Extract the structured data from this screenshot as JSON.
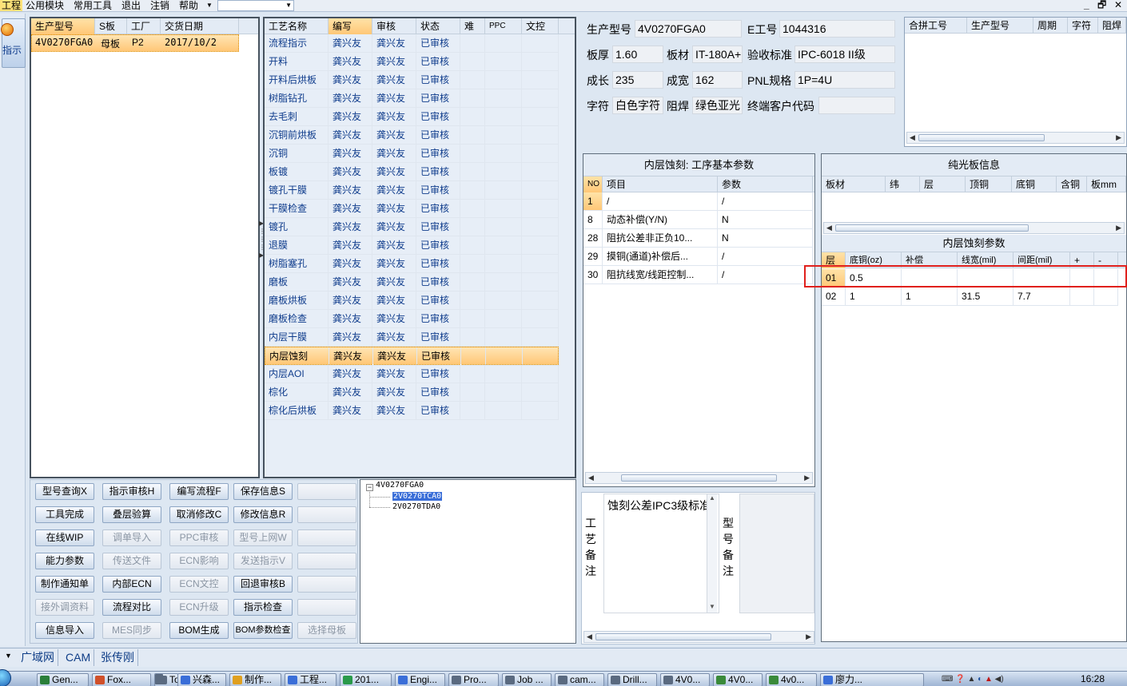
{
  "menubar": {
    "items": [
      "工程",
      "公用模块",
      "常用工具",
      "退出",
      "注销",
      "帮助"
    ],
    "window_buttons": [
      "_",
      "🗗",
      "✕"
    ]
  },
  "left_toolbar": {
    "label": "指示"
  },
  "model_list": {
    "columns": [
      "生产型号",
      "S板",
      "工厂",
      "交货日期"
    ],
    "rows": [
      [
        "4V0270FGA0",
        "母板",
        "P2",
        "2017/10/2"
      ]
    ]
  },
  "process_list": {
    "columns": [
      "工艺名称",
      "编写",
      "审核",
      "状态",
      "难",
      "PPC",
      "文控"
    ],
    "rows": [
      [
        "流程指示",
        "龚兴友",
        "龚兴友",
        "已审核"
      ],
      [
        "开料",
        "龚兴友",
        "龚兴友",
        "已审核"
      ],
      [
        "开料后烘板",
        "龚兴友",
        "龚兴友",
        "已审核"
      ],
      [
        "树脂钻孔",
        "龚兴友",
        "龚兴友",
        "已审核"
      ],
      [
        "去毛刺",
        "龚兴友",
        "龚兴友",
        "已审核"
      ],
      [
        "沉铜前烘板",
        "龚兴友",
        "龚兴友",
        "已审核"
      ],
      [
        "沉铜",
        "龚兴友",
        "龚兴友",
        "已审核"
      ],
      [
        "板镀",
        "龚兴友",
        "龚兴友",
        "已审核"
      ],
      [
        "镀孔干膜",
        "龚兴友",
        "龚兴友",
        "已审核"
      ],
      [
        "干膜检查",
        "龚兴友",
        "龚兴友",
        "已审核"
      ],
      [
        "镀孔",
        "龚兴友",
        "龚兴友",
        "已审核"
      ],
      [
        "退膜",
        "龚兴友",
        "龚兴友",
        "已审核"
      ],
      [
        "树脂塞孔",
        "龚兴友",
        "龚兴友",
        "已审核"
      ],
      [
        "磨板",
        "龚兴友",
        "龚兴友",
        "已审核"
      ],
      [
        "磨板烘板",
        "龚兴友",
        "龚兴友",
        "已审核"
      ],
      [
        "磨板检查",
        "龚兴友",
        "龚兴友",
        "已审核"
      ],
      [
        "内层干膜",
        "龚兴友",
        "龚兴友",
        "已审核"
      ],
      [
        "内层蚀刻",
        "龚兴友",
        "龚兴友",
        "已审核"
      ],
      [
        "内层AOI",
        "龚兴友",
        "龚兴友",
        "已审核"
      ],
      [
        "棕化",
        "龚兴友",
        "龚兴友",
        "已审核"
      ],
      [
        "棕化后烘板",
        "龚兴友",
        "龚兴友",
        "已审核"
      ]
    ],
    "selected_index": 17
  },
  "info": {
    "model_label": "生产型号",
    "model_value": "4V0270FGA0",
    "e_label": "E工号",
    "e_value": "1044316",
    "thickness_label": "板厚",
    "thickness_value": "1.60",
    "material_label": "板材",
    "material_value": "IT-180A+",
    "standard_label": "验收标准",
    "standard_value": "IPC-6018 II级",
    "length_label": "成长",
    "length_value": "235",
    "width_label": "成宽",
    "width_value": "162",
    "pnl_label": "PNL规格",
    "pnl_value": "1P=4U",
    "char_label": "字符",
    "char_value": "白色字符",
    "mask_label": "阻焊",
    "mask_value": "绿色亚光",
    "customer_label": "终端客户代码",
    "customer_value": ""
  },
  "merge_table": {
    "columns": [
      "合拼工号",
      "生产型号",
      "周期",
      "字符",
      "阻焊"
    ]
  },
  "base_params": {
    "title": "内层蚀刻: 工序基本参数",
    "columns": [
      "NO",
      "项目",
      "参数"
    ],
    "rows": [
      [
        "1",
        "/",
        "/"
      ],
      [
        "8",
        "动态补偿(Y/N)",
        "N"
      ],
      [
        "28",
        "阻抗公差非正负10...",
        "N"
      ],
      [
        "29",
        "摸铜(通道)补偿后...",
        "/"
      ],
      [
        "30",
        "阻抗线宽/线距控制...",
        "/"
      ]
    ]
  },
  "bare_board": {
    "title": "纯光板信息",
    "columns": [
      "板材",
      "纬",
      "层",
      "顶铜",
      "底铜",
      "含铜",
      "板mm"
    ]
  },
  "etch_params": {
    "title": "内层蚀刻参数",
    "columns": [
      "层",
      "底铜(oz)",
      "补偿",
      "线宽(mil)",
      "间距(mil)",
      "+",
      "-"
    ],
    "rows": [
      [
        "01",
        "0.5",
        "",
        "",
        "",
        "",
        ""
      ],
      [
        "02",
        "1",
        "1",
        "31.5",
        "7.7",
        "",
        ""
      ]
    ]
  },
  "buttons": [
    [
      "型号查询X",
      "指示审核H",
      "编写流程F",
      "保存信息S",
      ""
    ],
    [
      "工具完成",
      "叠层验算",
      "取消修改C",
      "修改信息R",
      ""
    ],
    [
      "在线WIP",
      "调单导入",
      "PPC审核",
      "型号上网W",
      ""
    ],
    [
      "能力参数",
      "传送文件",
      "ECN影响",
      "发送指示V",
      ""
    ],
    [
      "制作通知单",
      "内部ECN",
      "ECN文控",
      "回退审核B",
      ""
    ],
    [
      "接外调资料",
      "流程对比",
      "ECN升级",
      "指示检查",
      ""
    ],
    [
      "信息导入",
      "MES同步",
      "BOM生成",
      "BOM参数检查",
      "选择母板"
    ]
  ],
  "disabled_buttons": [
    "调单导入",
    "PPC审核",
    "型号上网W",
    "传送文件",
    "ECN影响",
    "发送指示V",
    "ECN文控",
    "接外调资料",
    "ECN升级",
    "MES同步",
    "选择母板"
  ],
  "tree": {
    "root": "4V0270FGA0",
    "children": [
      "2V0270TCA0",
      "2V0270TDA0"
    ],
    "selected": "2V0270TCA0"
  },
  "notes": {
    "craft_label": "工艺备注",
    "craft_text": "蚀刻公差IPC3级标准",
    "model_label": "型号备注"
  },
  "status_tabs": [
    "广域网",
    "CAM",
    "张传刚"
  ],
  "taskbar": {
    "items": [
      "Gen...",
      "Fox...",
      "Tot...",
      "兴森...",
      "制作...",
      "工程...",
      "201...",
      "Engi...",
      "Pro...",
      "Job ...",
      "cam...",
      "Drill...",
      "4V0...",
      "4V0...",
      "4v0...",
      "廖力..."
    ],
    "clock": "16:28"
  },
  "colors": {
    "accent": "#ffc777",
    "highlight_box": "#e0201c",
    "text_blue": "#0f3c8c"
  }
}
